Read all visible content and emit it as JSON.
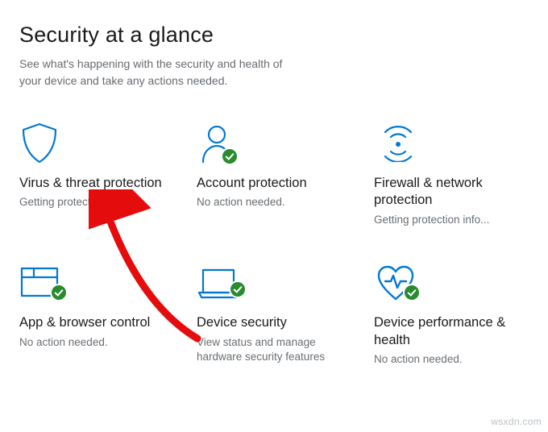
{
  "header": {
    "title": "Security at a glance",
    "subtitle": "See what's happening with the security and health of your device and take any actions needed."
  },
  "cards": {
    "virus": {
      "icon": "shield-icon",
      "title": "Virus & threat protection",
      "sub": "Getting protection info...",
      "badge": false
    },
    "account": {
      "icon": "account-icon",
      "title": "Account protection",
      "sub": "No action needed.",
      "badge": true
    },
    "firewall": {
      "icon": "firewall-icon",
      "title": "Firewall & network protection",
      "sub": "Getting protection info...",
      "badge": false
    },
    "app": {
      "icon": "app-browser-icon",
      "title": "App & browser control",
      "sub": "No action needed.",
      "badge": true
    },
    "device": {
      "icon": "device-icon",
      "title": "Device security",
      "sub": "View status and manage hardware security features",
      "badge": true
    },
    "health": {
      "icon": "health-icon",
      "title": "Device performance & health",
      "sub": "No action needed.",
      "badge": true
    }
  },
  "colors": {
    "iconStroke": "#0078d4",
    "badge": "#2a8a2f"
  },
  "watermark": "wsxdn.com"
}
